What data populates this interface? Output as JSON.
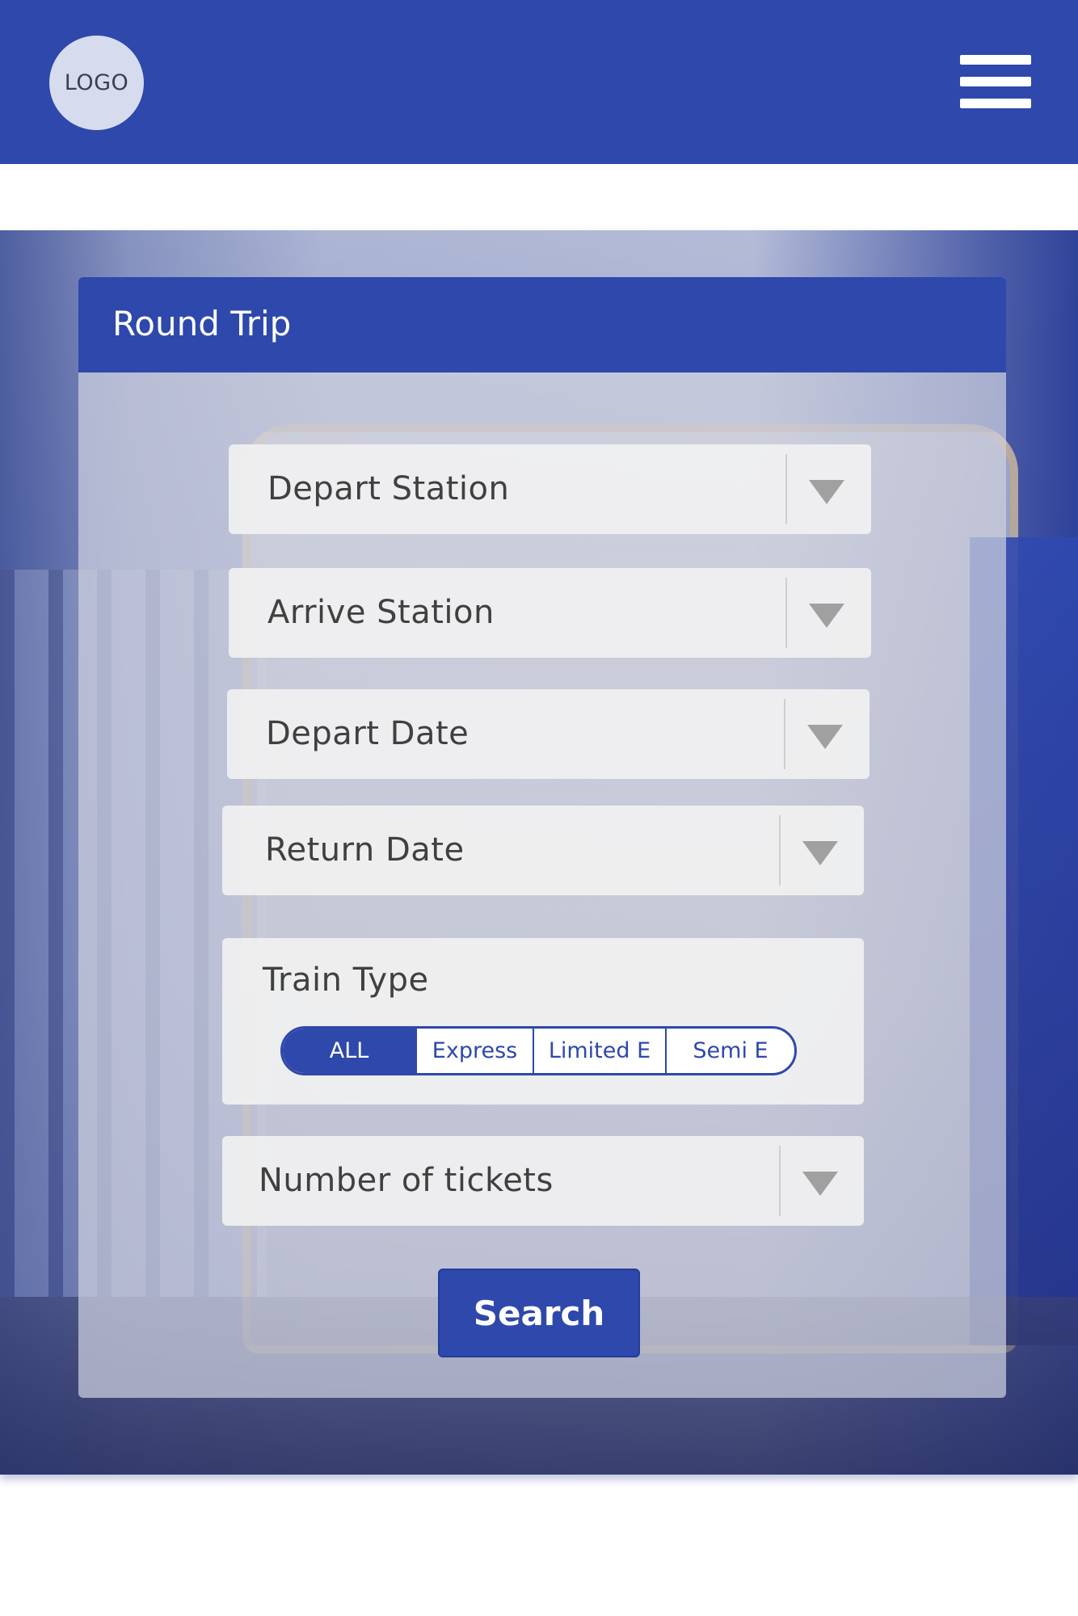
{
  "header": {
    "logo_text": "LOGO",
    "menu_icon": "hamburger-menu-icon"
  },
  "form": {
    "title": "Round Trip",
    "depart_station": "Depart Station",
    "arrive_station": "Arrive Station",
    "depart_date": "Depart Date",
    "return_date": "Return Date",
    "train_type": {
      "label": "Train Type",
      "options": [
        "ALL",
        "Express",
        "Limited E",
        "Semi E"
      ],
      "selected": "ALL"
    },
    "tickets": "Number of tickets",
    "search_label": "Search"
  },
  "colors": {
    "brand": "#2e48ab",
    "field_bg": "#f2f2f2",
    "text": "#404040"
  }
}
